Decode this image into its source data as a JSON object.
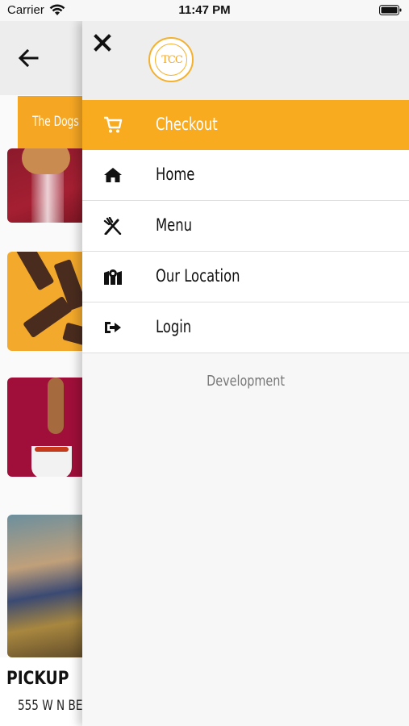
{
  "status_bar": {
    "carrier": "Carrier",
    "time": "11:47 PM",
    "icons": [
      "wifi-icon",
      "battery-icon"
    ]
  },
  "background": {
    "banner_text": "The Dogs",
    "footer_title": "PICKUP",
    "footer_address": "555 W N BE"
  },
  "drawer": {
    "logo_text": "TCC",
    "menu": [
      {
        "label": "Checkout",
        "icon": "cart-icon",
        "active": true
      },
      {
        "label": "Home",
        "icon": "home-icon",
        "active": false
      },
      {
        "label": "Menu",
        "icon": "fork-knife-icon",
        "active": false
      },
      {
        "label": "Our Location",
        "icon": "map-pin-icon",
        "active": false
      },
      {
        "label": "Login",
        "icon": "login-icon",
        "active": false
      }
    ],
    "footer_label": "Development"
  },
  "colors": {
    "accent": "#f9ab1f",
    "drawer_bg": "#f7f7f7",
    "header_bg": "#eeeeee"
  }
}
